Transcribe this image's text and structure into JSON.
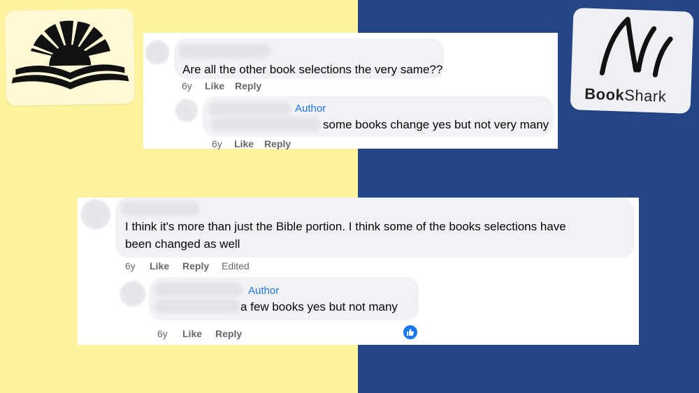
{
  "colors": {
    "left_bg": "#fdf29d",
    "right_bg": "#244586",
    "author_blue": "#1b74e4",
    "like_blue": "#1877f2"
  },
  "logos": {
    "left_icon": "open-book-sunrise-icon",
    "right_brand": {
      "bold": "Book",
      "rest": "Shark"
    }
  },
  "thread1": {
    "comment": {
      "text": "Are all the other book selections the very same??",
      "time": "6y",
      "like": "Like",
      "reply": "Reply"
    },
    "reply": {
      "author_label": "Author",
      "text": "some books change yes but not very many",
      "time": "6y",
      "like": "Like",
      "reply": "Reply"
    }
  },
  "thread2": {
    "comment": {
      "text_line1": "I think it's more than just the Bible portion. I think some of the books selections have",
      "text_line2": "been changed as well",
      "time": "6y",
      "like": "Like",
      "reply": "Reply",
      "edited": "Edited"
    },
    "reply": {
      "author_label": "Author",
      "text": "a few books yes but not many",
      "time": "6y",
      "like": "Like",
      "reply": "Reply",
      "reaction_icon": "thumbs-up-icon"
    }
  }
}
